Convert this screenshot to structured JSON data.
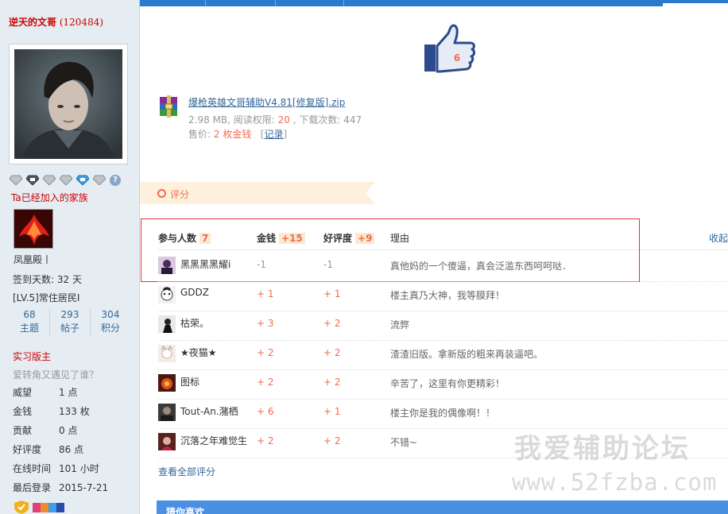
{
  "sidebar": {
    "username": "逆天的文哥",
    "uid": "(120484)",
    "family_note": "Ta已经加入的家族",
    "family_name": "凤凰殿丨",
    "checkin": "签到天数: 32 天",
    "level": "[LV.5]常住居民I",
    "stats": [
      {
        "num": "68",
        "label": "主题"
      },
      {
        "num": "293",
        "label": "帖子"
      },
      {
        "num": "304",
        "label": "积分"
      }
    ],
    "role": "实习版主",
    "motto": "爱转角又遇见了谁？",
    "info": [
      {
        "key": "威望",
        "value": "1 点"
      },
      {
        "key": "金钱",
        "value": "133 枚"
      },
      {
        "key": "贡献",
        "value": "0 点"
      },
      {
        "key": "好评度",
        "value": "86 点"
      },
      {
        "key": "在线时间",
        "value": "101 小时"
      },
      {
        "key": "最后登录",
        "value": "2015-7-21"
      }
    ]
  },
  "like": {
    "count": "6"
  },
  "attachment": {
    "filename": "爆枪英雄文哥辅助V4.81[修复版].zip",
    "size": "2.98 MB",
    "perm_label": "阅读权限:",
    "perm_value": "20",
    "downloads_label": "下载次数:",
    "downloads": "447",
    "price_label": "售价:",
    "price_value": "2 枚金钱",
    "record_link": "记录"
  },
  "rating": {
    "tab_label": "评分",
    "headers": {
      "participants": "参与人数",
      "participants_count": "7",
      "gold": "金钱",
      "gold_total": "+15",
      "rep": "好评度",
      "rep_total": "+9",
      "reason": "理由"
    },
    "collapse": "收起",
    "rows": [
      {
        "name": "黑黑黑黑耀i",
        "gold": "-1",
        "rep": "-1",
        "reason": "真他妈的一个傻逼，真会泛滥东西呵呵哒．"
      },
      {
        "name": "GDDZ",
        "gold": "+ 1",
        "rep": "+ 1",
        "reason": "楼主真乃大神，我等膜拜！"
      },
      {
        "name": "枯荣。",
        "gold": "+ 3",
        "rep": "+ 2",
        "reason": "流弊"
      },
      {
        "name": "★夜猫★",
        "gold": "+ 2",
        "rep": "+ 2",
        "reason": "渣渣旧版。拿新版的粗来再装逼吧。"
      },
      {
        "name": "图标",
        "gold": "+ 2",
        "rep": "+ 2",
        "reason": "辛苦了，这里有你更精彩！"
      },
      {
        "name": "Tout-An.潴栖",
        "gold": "+ 6",
        "rep": "+ 1",
        "reason": "楼主你是我的偶像啊！！"
      },
      {
        "name": "沉落之年难觉生",
        "gold": "+ 2",
        "rep": "+ 2",
        "reason": "不错~"
      }
    ],
    "view_all": "查看全部评分"
  },
  "bottom_bar": "猜你喜欢",
  "watermark": {
    "line1": "我爱辅助论坛",
    "line2": "www.52fzba.com"
  }
}
